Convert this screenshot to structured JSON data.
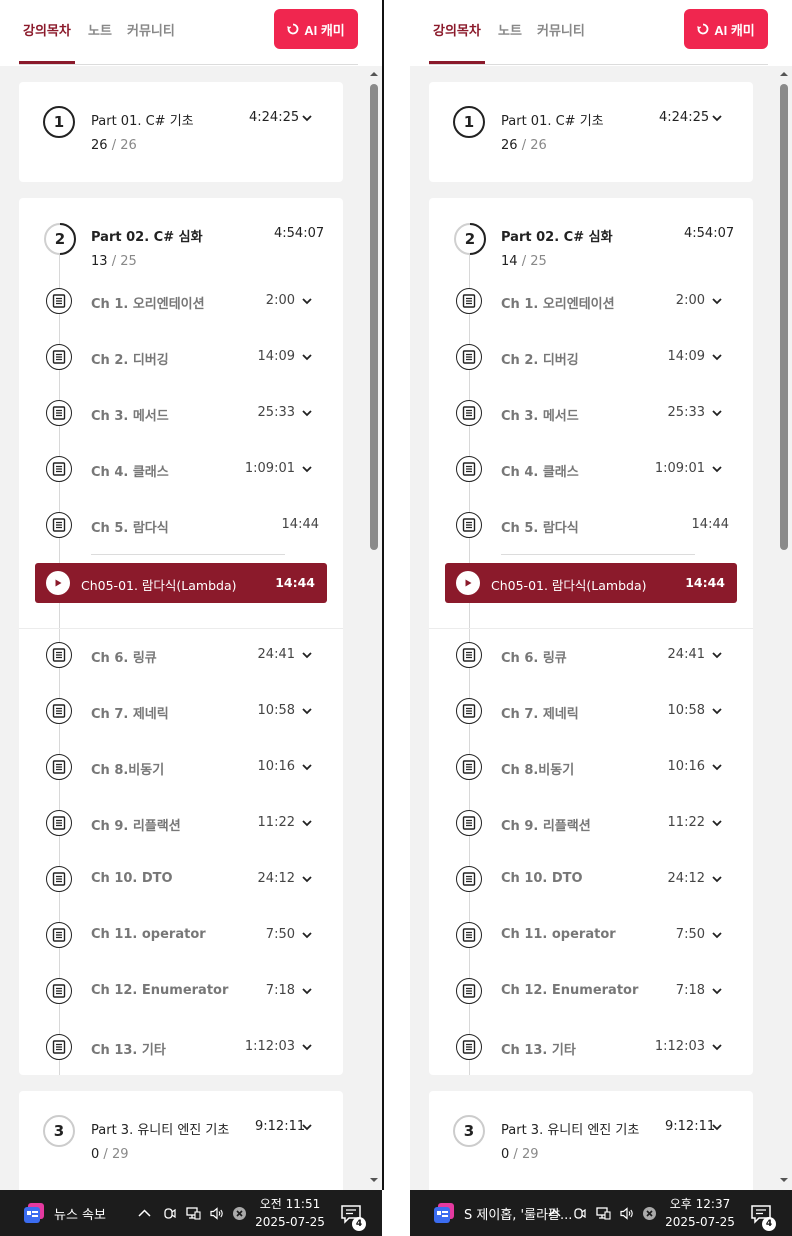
{
  "colors": {
    "accent": "#8b1a2b",
    "ai_button": "#f0264f",
    "taskbar": "#1c1c1c"
  },
  "panels": [
    {
      "tabs": [
        "강의목차",
        "노트",
        "커뮤니티"
      ],
      "ai_button": "AI 캐미",
      "part1": {
        "number": "1",
        "title": "Part 01. C# 기초",
        "duration": "4:24:25",
        "done": "26",
        "sep": "/",
        "total": "26"
      },
      "part2": {
        "number": "2",
        "title": "Part 02. C# 심화",
        "duration": "4:54:07",
        "done": "13",
        "sep": "/",
        "total": "25"
      },
      "chapters_a": [
        {
          "label": "Ch 1. 오리엔테이션",
          "time": "2:00"
        },
        {
          "label": "Ch 2. 디버깅",
          "time": "14:09"
        },
        {
          "label": "Ch 3. 메서드",
          "time": "25:33"
        },
        {
          "label": "Ch 4. 클래스",
          "time": "1:09:01"
        },
        {
          "label": "Ch 5. 람다식",
          "time": "14:44"
        }
      ],
      "lesson": {
        "label": "Ch05-01. 람다식(Lambda)",
        "time": "14:44"
      },
      "chapters_b": [
        {
          "label": "Ch 6. 링큐",
          "time": "24:41"
        },
        {
          "label": "Ch 7. 제네릭",
          "time": "10:58"
        },
        {
          "label": "Ch 8.비동기",
          "time": "10:16"
        },
        {
          "label": "Ch 9. 리플랙션",
          "time": "11:22"
        },
        {
          "label": "Ch 10. DTO",
          "time": "24:12"
        },
        {
          "label": "Ch 11. operator",
          "time": "7:50"
        },
        {
          "label": "Ch 12. Enumerator",
          "time": "7:18"
        },
        {
          "label": "Ch 13. 기타",
          "time": "1:12:03"
        }
      ],
      "part3": {
        "number": "3",
        "title": "Part 3. 유니티 엔진 기초",
        "duration": "9:12:11",
        "done": "0",
        "sep": "/",
        "total": "29"
      },
      "taskbar": {
        "news": "뉴스 속보",
        "time": "오전 11:51",
        "date": "2025-07-25",
        "badge": "4"
      }
    },
    {
      "tabs": [
        "강의목차",
        "노트",
        "커뮤니티"
      ],
      "ai_button": "AI 캐미",
      "part1": {
        "number": "1",
        "title": "Part 01. C# 기초",
        "duration": "4:24:25",
        "done": "26",
        "sep": "/",
        "total": "26"
      },
      "part2": {
        "number": "2",
        "title": "Part 02. C# 심화",
        "duration": "4:54:07",
        "done": "14",
        "sep": "/",
        "total": "25"
      },
      "chapters_a": [
        {
          "label": "Ch 1. 오리엔테이션",
          "time": "2:00"
        },
        {
          "label": "Ch 2. 디버깅",
          "time": "14:09"
        },
        {
          "label": "Ch 3. 메서드",
          "time": "25:33"
        },
        {
          "label": "Ch 4. 클래스",
          "time": "1:09:01"
        },
        {
          "label": "Ch 5. 람다식",
          "time": "14:44"
        }
      ],
      "lesson": {
        "label": "Ch05-01. 람다식(Lambda)",
        "time": "14:44"
      },
      "chapters_b": [
        {
          "label": "Ch 6. 링큐",
          "time": "24:41"
        },
        {
          "label": "Ch 7. 제네릭",
          "time": "10:58"
        },
        {
          "label": "Ch 8.비동기",
          "time": "10:16"
        },
        {
          "label": "Ch 9. 리플랙션",
          "time": "11:22"
        },
        {
          "label": "Ch 10. DTO",
          "time": "24:12"
        },
        {
          "label": "Ch 11. operator",
          "time": "7:50"
        },
        {
          "label": "Ch 12. Enumerator",
          "time": "7:18"
        },
        {
          "label": "Ch 13. 기타",
          "time": "1:12:03"
        }
      ],
      "part3": {
        "number": "3",
        "title": "Part 3. 유니티 엔진 기초",
        "duration": "9:12:11",
        "done": "0",
        "sep": "/",
        "total": "29"
      },
      "taskbar": {
        "news": "S 제이홉, '룰라팔...",
        "time": "오후 12:37",
        "date": "2025-07-25",
        "badge": "4"
      }
    }
  ]
}
